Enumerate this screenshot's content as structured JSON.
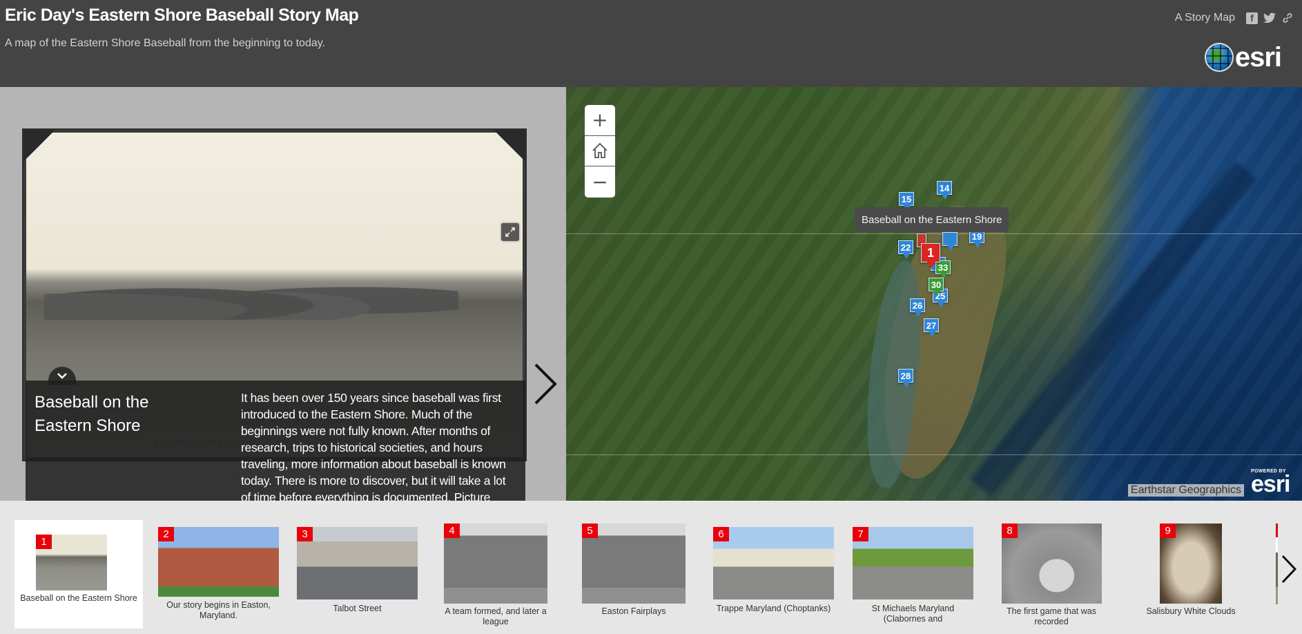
{
  "header": {
    "title": "Eric Day's Eastern Shore Baseball Story Map",
    "subtitle": "A map of the Eastern Shore Baseball from the beginning to today.",
    "storymap_link": "A Story Map",
    "share_icons": [
      "facebook-icon",
      "twitter-icon",
      "link-icon"
    ],
    "logo_text": "esri"
  },
  "media": {
    "photo_caption": "EASTERN SHORE LEAGUE",
    "story_title": "Baseball on the Eastern Shore",
    "story_text": "It has been over 150 years since baseball was first introduced to the Eastern Shore. Much of the beginnings were not fully known. After months of research, trips to historical societies, and hours traveling, more information about baseball is known today. There is more to discover, but it will take a lot of time before everything is documented. Picture provided by Eastern Shore: The Countryside Reformed.",
    "expand_icon": "expand-icon",
    "collapse_icon": "chevron-down-icon",
    "next_icon": "chevron-right-icon"
  },
  "map": {
    "zoom_in": "+",
    "home": "⌂",
    "zoom_out": "−",
    "tooltip": "Baseball on the Eastern Shore",
    "attribution": "Earthstar Geographics",
    "powered_by": "POWERED BY",
    "powered_logo": "esri",
    "markers": [
      {
        "label": "15",
        "color": "blue"
      },
      {
        "label": "14",
        "color": "blue"
      },
      {
        "label": "22",
        "color": "blue"
      },
      {
        "label": "19",
        "color": "blue"
      },
      {
        "label": "33",
        "color": "green"
      },
      {
        "label": "30",
        "color": "green"
      },
      {
        "label": "25",
        "color": "blue"
      },
      {
        "label": "26",
        "color": "blue"
      },
      {
        "label": "27",
        "color": "blue"
      },
      {
        "label": "28",
        "color": "blue"
      },
      {
        "label": "1",
        "color": "red"
      }
    ],
    "colors": {
      "marker_blue": "#2f86d8",
      "marker_green": "#3d9c35",
      "marker_red": "#d9261f"
    }
  },
  "carousel": {
    "items": [
      {
        "num": "1",
        "label": "Baseball on the Eastern Shore",
        "active": true
      },
      {
        "num": "2",
        "label": "Our story begins in Easton, Maryland."
      },
      {
        "num": "3",
        "label": "Talbot Street"
      },
      {
        "num": "4",
        "label": "A team formed, and later a league"
      },
      {
        "num": "5",
        "label": "Easton Fairplays"
      },
      {
        "num": "6",
        "label": "Trappe Maryland (Choptanks)"
      },
      {
        "num": "7",
        "label": "St Michaels Maryland (Clabornes and"
      },
      {
        "num": "8",
        "label": "The first game that was recorded"
      },
      {
        "num": "9",
        "label": "Salisbury White Clouds"
      }
    ],
    "accent_color": "#e8000b"
  }
}
